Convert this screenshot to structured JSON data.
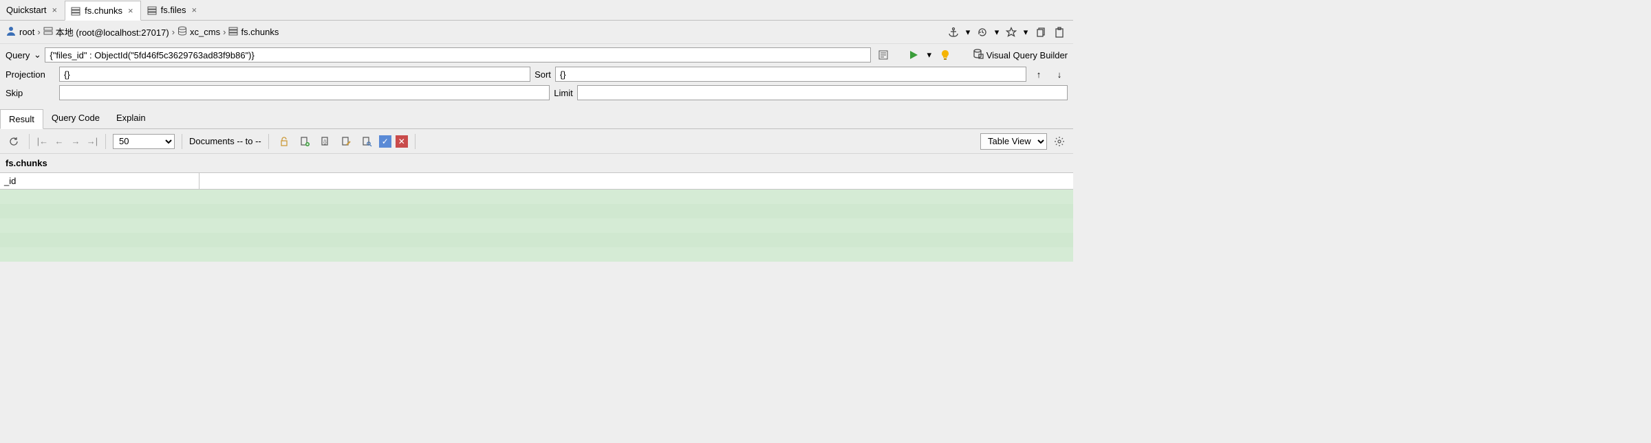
{
  "tabs": [
    {
      "label": "Quickstart",
      "icon": null,
      "active": false
    },
    {
      "label": "fs.chunks",
      "icon": "collection",
      "active": true
    },
    {
      "label": "fs.files",
      "icon": "collection",
      "active": false
    }
  ],
  "breadcrumb": {
    "root": "root",
    "conn": "本地 (root@localhost:27017)",
    "db": "xc_cms",
    "coll": "fs.chunks"
  },
  "query": {
    "label": "Query",
    "value": "{\"files_id\" : ObjectId(\"5fd46f5c3629763ad83f9b86\")}",
    "vqb_label": "Visual Query Builder",
    "projection_label": "Projection",
    "projection_value": "{}",
    "sort_label": "Sort",
    "sort_value": "{}",
    "skip_label": "Skip",
    "skip_value": "",
    "limit_label": "Limit",
    "limit_value": ""
  },
  "lower_tabs": [
    {
      "label": "Result",
      "active": true
    },
    {
      "label": "Query Code",
      "active": false
    },
    {
      "label": "Explain",
      "active": false
    }
  ],
  "results_toolbar": {
    "page_size": "50",
    "docs_label": "Documents -- to --",
    "view": "Table View"
  },
  "results": {
    "collection": "fs.chunks",
    "columns": [
      "_id",
      ""
    ],
    "rows": []
  }
}
